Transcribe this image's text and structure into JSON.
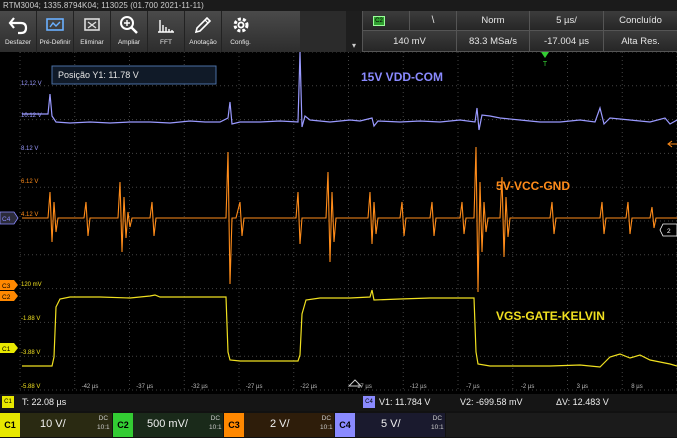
{
  "title_bar": "RTM3004; 1335.8794K04; 113025 (01.700 2021-11-11)",
  "toolbar": [
    {
      "label": "Desfazer",
      "icon": "undo-icon"
    },
    {
      "label": "Pré-Definir",
      "icon": "preset-icon"
    },
    {
      "label": "Eliminar",
      "icon": "delete-icon"
    },
    {
      "label": "Ampliar",
      "icon": "zoom-icon"
    },
    {
      "label": "FFT",
      "icon": "fft-icon"
    },
    {
      "label": "Anotação",
      "icon": "pencil-icon"
    },
    {
      "label": "Config.",
      "icon": "gear-icon"
    }
  ],
  "acquisition": {
    "trigger_source": "C2",
    "trigger_slope": "\\",
    "trigger_mode": "Norm",
    "timebase": "5 µs/",
    "run_state": "Concluído",
    "trigger_level": "140 mV",
    "sample_rate": "83.3 MSa/s",
    "position": "-17.004 µs",
    "resolution": "Alta Res.",
    "menu_arrow": "▾"
  },
  "cursor_box": "Posição Y1: 11.78 V",
  "annotations": {
    "c1": "15V VDD-COM",
    "c2": "5V-VCC-GND",
    "c3": "VGS-GATE-KELVIN"
  },
  "y_ticks_left": {
    "c1_top": "12.12 V",
    "c1_mid": "10.12 V",
    "c1_low": "8.12 V",
    "c2_top": "6.12 V",
    "c2_mid": "4.12 V",
    "c3_top": "120 mV",
    "c3_mid": "-1.88 V",
    "c3_low": "-3.88 V",
    "c3_bot": "-5.88 V"
  },
  "x_ticks": [
    "-42 µs",
    "-37 µs",
    "-32 µs",
    "-27 µs",
    "-22 µs",
    "-17 µs",
    "-12 µs",
    "-7 µs",
    "-2 µs",
    "3 µs",
    "8 µs"
  ],
  "channel_markers": {
    "c4": "C4",
    "c3": "C3",
    "c2": "C2",
    "c1": "C1",
    "ref2": "2"
  },
  "status": {
    "t_label": "C1",
    "t_value": "T: 22.08 µs",
    "cursor_ch": "C4",
    "v1": "V1: 11.784 V",
    "v2": "V2: -699.58 mV",
    "dv": "ΔV: 12.483 V"
  },
  "channels": [
    {
      "tag": "C1",
      "value": "10 V/",
      "dc": "DC",
      "ratio": "10:1",
      "color": "#e8e800"
    },
    {
      "tag": "C2",
      "value": "500 mV/",
      "dc": "DC",
      "ratio": "10:1",
      "color": "#33cc33"
    },
    {
      "tag": "C3",
      "value": "2 V/",
      "dc": "DC",
      "ratio": "10:1",
      "color": "#ff8800"
    },
    {
      "tag": "C4",
      "value": "5 V/",
      "dc": "DC",
      "ratio": "10:1",
      "color": "#8a8aff"
    }
  ],
  "colors": {
    "c1_trace": "#9a9aff",
    "c2_trace": "#ff8c1a",
    "c3_trace": "#f0e020",
    "grid": "#3a3a3a"
  }
}
